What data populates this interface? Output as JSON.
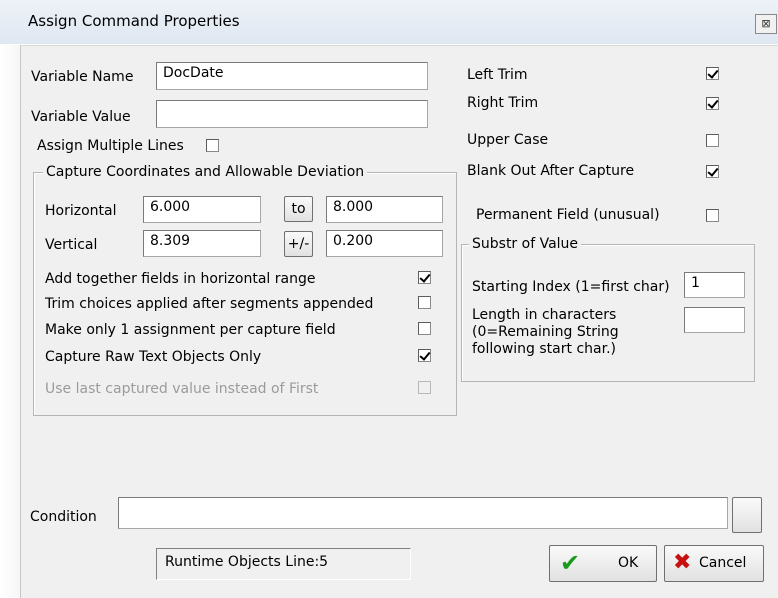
{
  "window": {
    "title": "Assign Command Properties",
    "close_glyph": "⊠"
  },
  "fields": {
    "variable_name_label": "Variable Name",
    "variable_name_value": "DocDate",
    "variable_value_label": "Variable Value",
    "variable_value_value": "",
    "assign_multiple_label": "Assign Multiple Lines"
  },
  "capture": {
    "legend": "Capture Coordinates and Allowable Deviation",
    "horizontal_label": "Horizontal",
    "horizontal_from": "6.000",
    "to_button": "to",
    "horizontal_to": "8.000",
    "vertical_label": "Vertical",
    "vertical_value": "8.309",
    "plusminus_button": "+/-",
    "vertical_dev": "0.200",
    "options": [
      {
        "label": "Add together fields in horizontal range",
        "checked": true,
        "disabled": false
      },
      {
        "label": "Trim choices applied after segments appended",
        "checked": false,
        "disabled": false
      },
      {
        "label": "Make only 1 assignment per capture field",
        "checked": false,
        "disabled": false
      },
      {
        "label": "Capture Raw Text Objects Only",
        "checked": true,
        "disabled": false
      },
      {
        "label": "Use last captured value instead of First",
        "checked": false,
        "disabled": true
      }
    ]
  },
  "right_options": {
    "left_trim": "Left Trim",
    "right_trim": "Right Trim",
    "upper_case": "Upper Case",
    "blank_out": "Blank Out After Capture",
    "permanent_field": "Permanent Field (unusual)"
  },
  "substr": {
    "legend": "Substr of Value",
    "start_label": "Starting Index (1=first char)",
    "start_value": "1",
    "length_line1": "Length in characters",
    "length_line2": "(0=Remaining String",
    "length_line3": "following start char.)",
    "length_value": ""
  },
  "condition": {
    "label": "Condition",
    "value": ""
  },
  "status": {
    "text": "Runtime Objects  Line:5"
  },
  "buttons": {
    "ok": "OK",
    "cancel": "Cancel"
  },
  "icons": {
    "ok": "check-icon",
    "cancel": "x-icon",
    "close": "close-icon"
  },
  "colors": {
    "ok_check": "#1a9a1a",
    "cancel_x": "#c81010",
    "dialog_bg": "#f0f0f0"
  }
}
